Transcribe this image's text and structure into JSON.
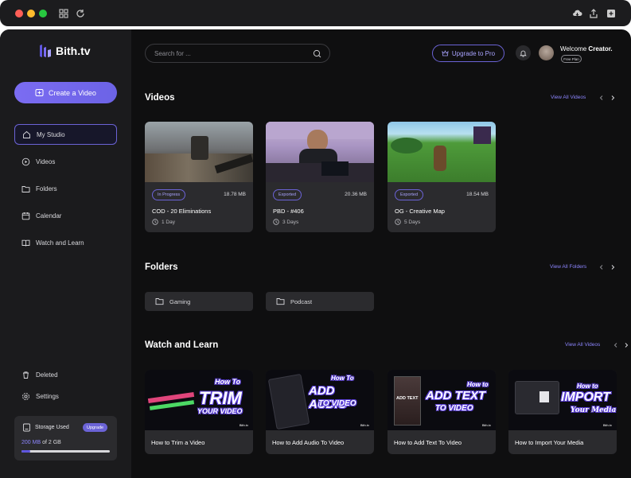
{
  "app": {
    "name": "Bith.tv"
  },
  "colors": {
    "accent": "#6b63d6",
    "accent_text": "#8d86ff",
    "bg": "#0f0f10",
    "sidebar": "#1b1b1d",
    "card": "#2b2b2e"
  },
  "sidebar": {
    "create_label": "Create a Video",
    "items": [
      {
        "label": "My Studio",
        "icon": "home-icon",
        "active": true
      },
      {
        "label": "Videos",
        "icon": "play-circle-icon"
      },
      {
        "label": "Folders",
        "icon": "folder-icon"
      },
      {
        "label": "Calendar",
        "icon": "calendar-icon"
      },
      {
        "label": "Watch and Learn",
        "icon": "book-icon"
      }
    ],
    "bottom_items": [
      {
        "label": "Deleted",
        "icon": "trash-icon"
      },
      {
        "label": "Settings",
        "icon": "gear-icon"
      }
    ],
    "storage": {
      "label": "Storage Used",
      "upgrade_label": "Upgrade",
      "used": "200 MB",
      "of_text": "of 2 GB",
      "fraction": 0.1
    }
  },
  "header": {
    "search_placeholder": "Search for ...",
    "upgrade_label": "Upgrade to Pro",
    "welcome_prefix": "Welcome ",
    "user_name": "Creator.",
    "plan": "Free Plan"
  },
  "videos": {
    "title": "Videos",
    "view_all": "View All Videos",
    "items": [
      {
        "status": "In Progress",
        "size": "18.78 MB",
        "title": "COD - 20 Eliminations",
        "duration": "1 Day"
      },
      {
        "status": "Exported",
        "size": "20.36 MB",
        "title": "PBD - #406",
        "duration": "3 Days"
      },
      {
        "status": "Exported",
        "size": "18.54 MB",
        "title": "OG - Creative Map",
        "duration": "5 Days"
      }
    ]
  },
  "folders": {
    "title": "Folders",
    "view_all": "View All Folders",
    "items": [
      "Gaming",
      "Podcast"
    ]
  },
  "learn": {
    "title": "Watch and Learn",
    "view_all": "View All Videos",
    "items": [
      {
        "title": "How to Trim a Video",
        "how": "How To",
        "big": "TRIM",
        "sub": "YOUR VIDEO"
      },
      {
        "title": "How to Add Audio To Video",
        "how": "How To",
        "big": "ADD AUDIO",
        "sub": "TO VIDEO"
      },
      {
        "title": "How to Add Text To Video",
        "how": "How to",
        "big": "ADD TEXT",
        "sub": "TO VIDEO"
      },
      {
        "title": "How to Import Your Media",
        "how": "How to",
        "big": "IMPORT",
        "sub": "Your Media"
      }
    ],
    "watermark": "Bith.tv",
    "thumb_text": "ADD TEXT"
  }
}
